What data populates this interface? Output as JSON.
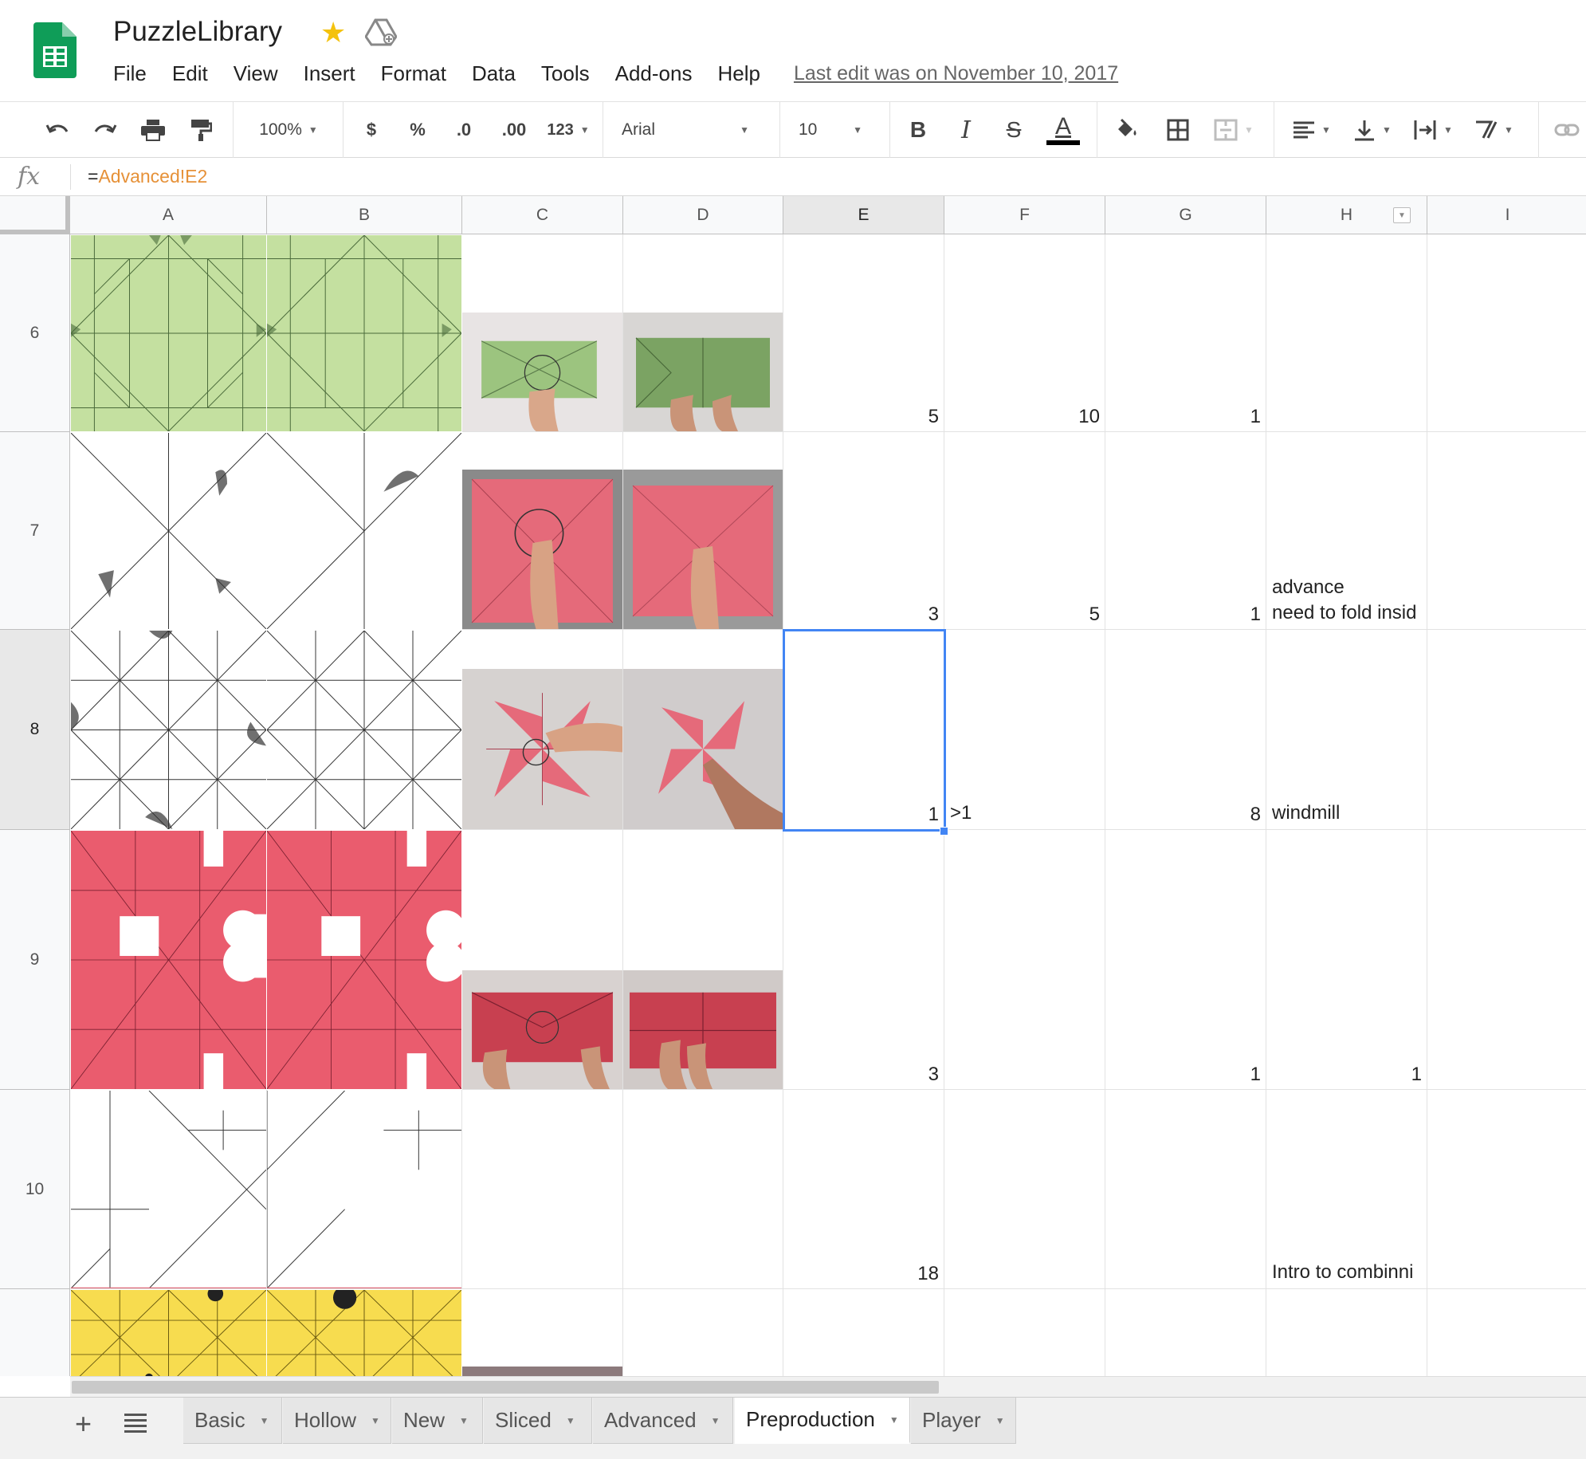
{
  "app": {
    "title": "PuzzleLibrary",
    "last_edit": "Last edit was on November 10, 2017",
    "menu": [
      "File",
      "Edit",
      "View",
      "Insert",
      "Format",
      "Data",
      "Tools",
      "Add-ons",
      "Help"
    ]
  },
  "toolbar": {
    "zoom": "100%",
    "currency": "$",
    "percent": "%",
    "decrease_decimal": ".0",
    "increase_decimal": ".00",
    "more_formats": "123",
    "font": "Arial",
    "font_size": "10",
    "bold": "B",
    "italic": "I",
    "strike": "S",
    "text_color_glyph": "A"
  },
  "formula_bar": {
    "fx": "fx",
    "prefix": "=",
    "reference": "Advanced!E2"
  },
  "columns": [
    "A",
    "B",
    "C",
    "D",
    "E",
    "F",
    "G",
    "H",
    "I"
  ],
  "rows": [
    {
      "label": "6",
      "E": "5",
      "F": "10",
      "G": "1",
      "H": "",
      "H_num": ""
    },
    {
      "label": "7",
      "E": "3",
      "F": "5",
      "G": "1",
      "H_line1": "advance",
      "H": "need to fold insid",
      "H_num": ""
    },
    {
      "label": "8",
      "E": "1",
      "F": ">1",
      "G": "8",
      "H": "windmill",
      "H_num": ""
    },
    {
      "label": "9",
      "E": "3",
      "F": "",
      "G": "1",
      "H": "",
      "H_num": "1"
    },
    {
      "label": "10",
      "E": "18",
      "F": "",
      "G": "",
      "H": "Intro to combinni",
      "H_num": ""
    },
    {
      "label": "",
      "E": "",
      "F": "",
      "G": "",
      "H": "",
      "H_num": ""
    }
  ],
  "selected_cell": "E8",
  "sheets": [
    "Basic",
    "Hollow",
    "New",
    "Sliced",
    "Advanced",
    "Preproduction",
    "Player"
  ],
  "active_sheet": "Preproduction",
  "colors": {
    "green_paper": "#c4e0a0",
    "pink_paper": "#ea5c6e",
    "yellow_paper": "#f7dc4f",
    "selection_blue": "#4285f4"
  }
}
